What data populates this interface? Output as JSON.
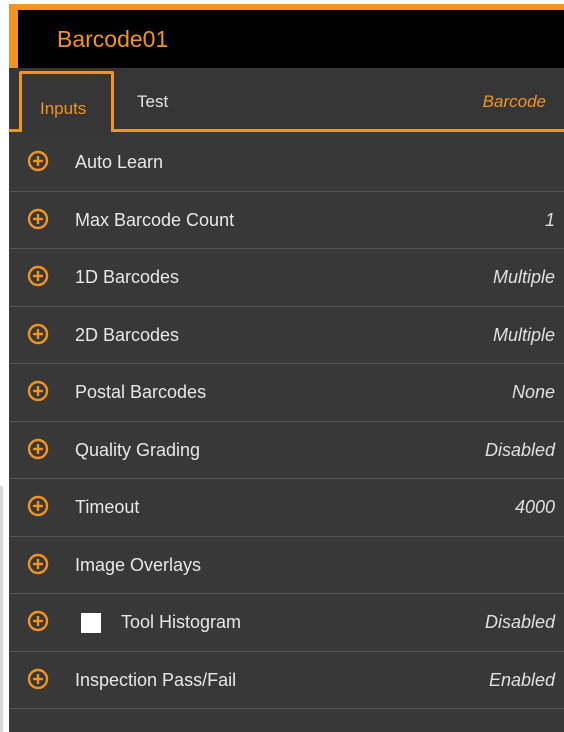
{
  "window": {
    "title": "Barcode01"
  },
  "tabs": {
    "inputs_label": "Inputs",
    "test_label": "Test",
    "tool_type": "Barcode"
  },
  "rows": [
    {
      "label": "Auto Learn",
      "value": "",
      "icon": "plus-circle-icon"
    },
    {
      "label": "Max Barcode Count",
      "value": "1",
      "icon": "plus-circle-icon"
    },
    {
      "label": "1D Barcodes",
      "value": "Multiple",
      "icon": "plus-circle-icon"
    },
    {
      "label": "2D Barcodes",
      "value": "Multiple",
      "icon": "plus-circle-icon"
    },
    {
      "label": "Postal Barcodes",
      "value": "None",
      "icon": "plus-circle-icon"
    },
    {
      "label": "Quality Grading",
      "value": "Disabled",
      "icon": "plus-circle-icon"
    },
    {
      "label": "Timeout",
      "value": "4000",
      "icon": "plus-circle-icon"
    },
    {
      "label": "Image Overlays",
      "value": "",
      "icon": "plus-circle-icon"
    },
    {
      "label": "Tool Histogram",
      "value": "Disabled",
      "icon": "plus-circle-icon",
      "checkbox": true,
      "checked": false
    },
    {
      "label": "Inspection Pass/Fail",
      "value": "Enabled",
      "icon": "plus-circle-icon"
    }
  ],
  "colors": {
    "accent": "#f39321",
    "panel": "#383838",
    "title_bar": "#000000",
    "text": "#e8e8e8"
  }
}
